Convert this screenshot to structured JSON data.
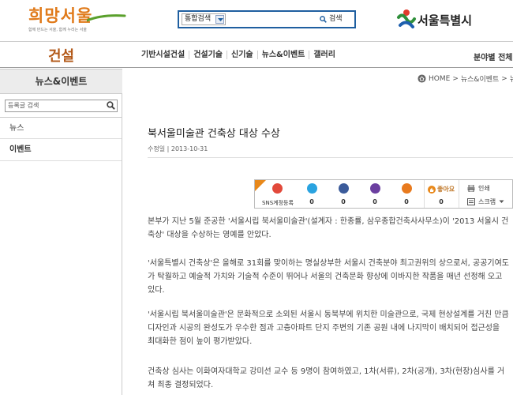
{
  "header": {
    "logo_main": "희망서울",
    "logo_tagline": "함께 만드는 서울, 함께 누리는 서울",
    "search": {
      "scope_selected": "통합검색",
      "input_value": "",
      "button_label": "검색"
    },
    "city_logo_text": "서울특별시"
  },
  "nav": {
    "section_title": "건설",
    "items": [
      "기반시설건설",
      "건설기술",
      "신기술",
      "뉴스&이벤트",
      "갤러리"
    ],
    "right_label": "분야별 전체"
  },
  "sidebar": {
    "title": "뉴스&이벤트",
    "search_placeholder": "등록글 검색",
    "items": [
      "뉴스",
      "이벤트"
    ]
  },
  "breadcrumb": {
    "home": "HOME",
    "sep": ">",
    "level1": "뉴스&이벤트",
    "level2": "뉴"
  },
  "article": {
    "title": "북서울미술관 건축상 대상 수상",
    "date": "수정일 | 2013-10-31",
    "sns": {
      "register_label": "SNS계정등록",
      "counts": [
        "0",
        "0",
        "0",
        "0",
        "0"
      ],
      "like_label": "좋아요",
      "like_count": "0",
      "print_label": "인쇄",
      "scrap_label": "스크랩"
    },
    "paragraphs": [
      "본부가 지난 5월 준공한 '서울시립 북서울미술관'(설계자 : 한종률, 삼우종합건축사사무소)이 '2013 서울시 건축상' 대상을 수상하는 영예를 안았다.",
      "'서울특별시 건축상'은 올해로 31회를 맞이하는 명실상부한 서울시 건축분야 최고권위의 상으로서, 공공기여도가 탁월하고 예술적 가치와 기술적 수준이 뛰어나 서울의 건축문화 향상에 이바지한 작품을 매년 선정해 오고 있다.",
      "'서울시립 북서울미술관'은 문화적으로 소외된 서울시 동북부에 위치한 미술관으로, 국제 현상설계를 거친 만큼 디자인과 시공의 완성도가 우수한 점과 고층아파트 단지 주변의 기존 공원 내에 나지막이 배치되어 접근성을 최대화한 점이 높이 평가받았다.",
      "건축상 심사는 이화여자대학교 강미선 교수 등 9명이 참여하였고, 1차(서류), 2차(공개), 3차(현장)심사를 거쳐 최종 결정되었다."
    ]
  },
  "colors": {
    "logo_orange": "#e07a1a",
    "logo_green": "#5aa02c",
    "search_border": "#1f5fa0",
    "nav_title": "#b35a1a",
    "sns_badge": "#e8881a"
  }
}
